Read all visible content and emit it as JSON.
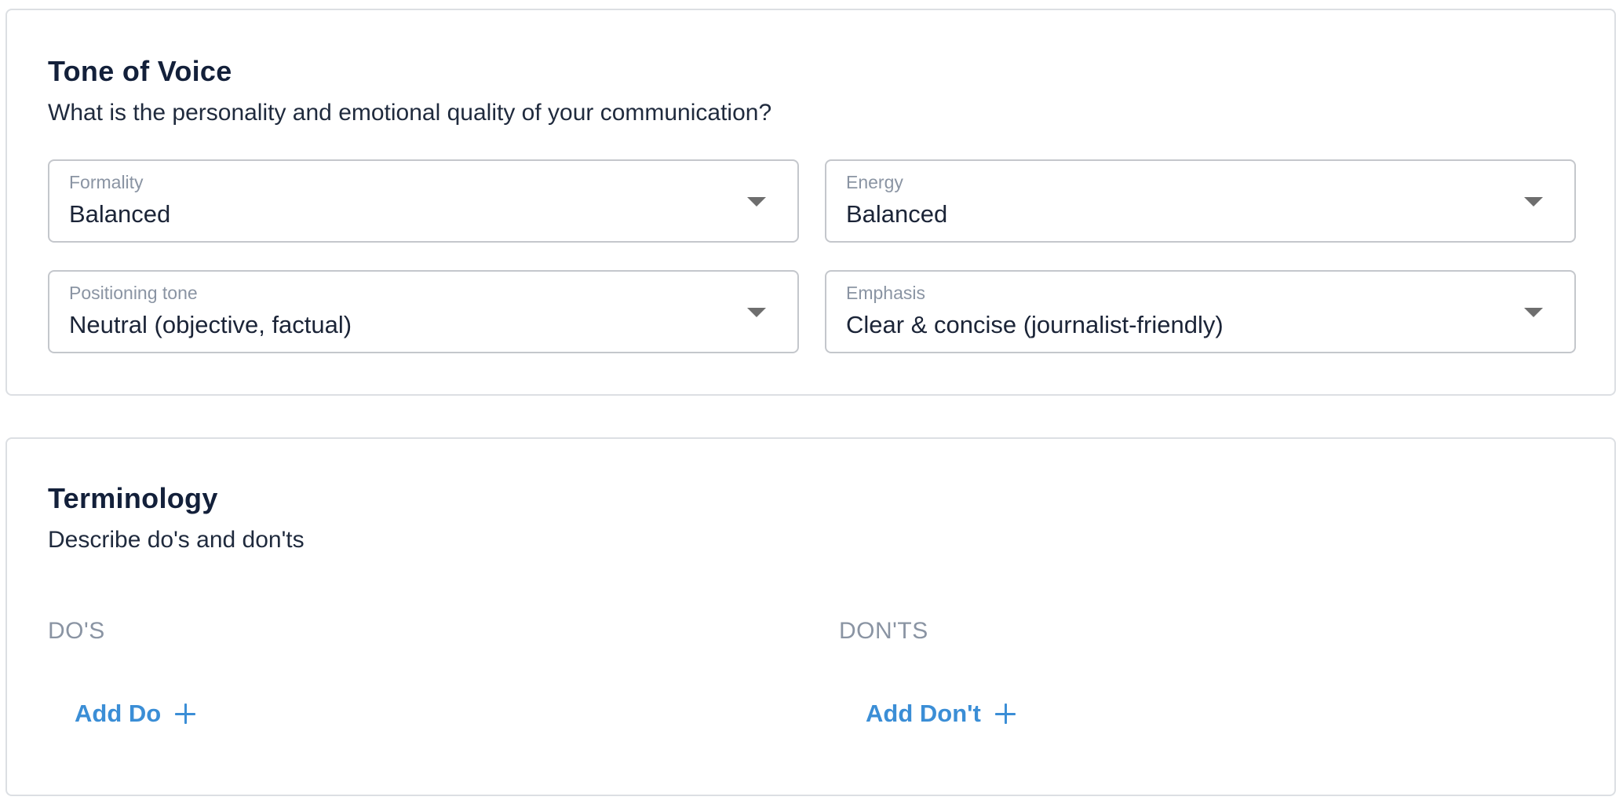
{
  "tone_of_voice": {
    "title": "Tone of Voice",
    "subtitle": "What is the personality and emotional quality of your communication?",
    "fields": {
      "formality": {
        "label": "Formality",
        "value": "Balanced"
      },
      "energy": {
        "label": "Energy",
        "value": "Balanced"
      },
      "positioning": {
        "label": "Positioning tone",
        "value": "Neutral (objective, factual)"
      },
      "emphasis": {
        "label": "Emphasis",
        "value": "Clear & concise (journalist-friendly)"
      }
    }
  },
  "terminology": {
    "title": "Terminology",
    "subtitle": "Describe do's and don'ts",
    "dos": {
      "heading": "DO'S",
      "add_label": "Add Do"
    },
    "donts": {
      "heading": "DON'TS",
      "add_label": "Add Don't"
    }
  },
  "icons": {
    "dropdown": "chevron-down-icon",
    "add": "plus-icon"
  },
  "colors": {
    "accent": "#3b8ed6",
    "title": "#13203a",
    "muted": "#8a94a3",
    "border": "#dcdfe3"
  }
}
